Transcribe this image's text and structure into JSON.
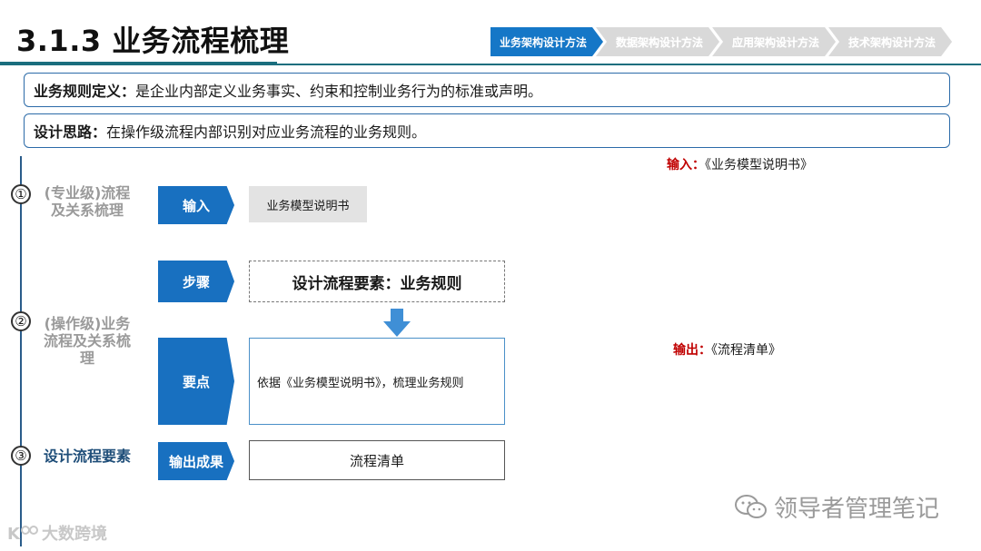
{
  "header": {
    "title": "3.1.3 业务流程梳理",
    "nav": [
      {
        "label": "业务架构设计方法",
        "active": true
      },
      {
        "label": "数据架构设计方法",
        "active": false
      },
      {
        "label": "应用架构设计方法",
        "active": false
      },
      {
        "label": "技术架构设计方法",
        "active": false
      }
    ]
  },
  "definition": {
    "key": "业务规则定义：",
    "text": "是企业内部定义业务事实、约束和控制业务行为的标准或声明。"
  },
  "design": {
    "key": "设计思路：",
    "text": "在操作级流程内部识别对应业务流程的业务规则。"
  },
  "phases": [
    {
      "num": "①",
      "label": "(专业级)流程及关系梳理",
      "active": false
    },
    {
      "num": "②",
      "label": "(操作级)业务流程及关系梳理",
      "active": false
    },
    {
      "num": "③",
      "label": "设计流程要素",
      "active": true
    }
  ],
  "rows": {
    "input": {
      "tag": "输入",
      "content": "业务模型说明书"
    },
    "step": {
      "tag": "步骤",
      "content": "设计流程要素：业务规则"
    },
    "points": {
      "tag": "要点",
      "content": "依据《业务模型说明书》，梳理业务规则"
    },
    "output": {
      "tag": "输出成果",
      "content": "流程清单"
    }
  },
  "notes": {
    "input_key": "输入：",
    "input_val": "《业务模型说明书》",
    "output_key": "输出：",
    "output_val": "《流程清单》"
  },
  "watermark": "领导者管理笔记",
  "corner_logo": "大数跨境",
  "colors": {
    "accent": "#1870c0",
    "header_rule": "#1a6e7e",
    "note_key": "#c00000"
  }
}
